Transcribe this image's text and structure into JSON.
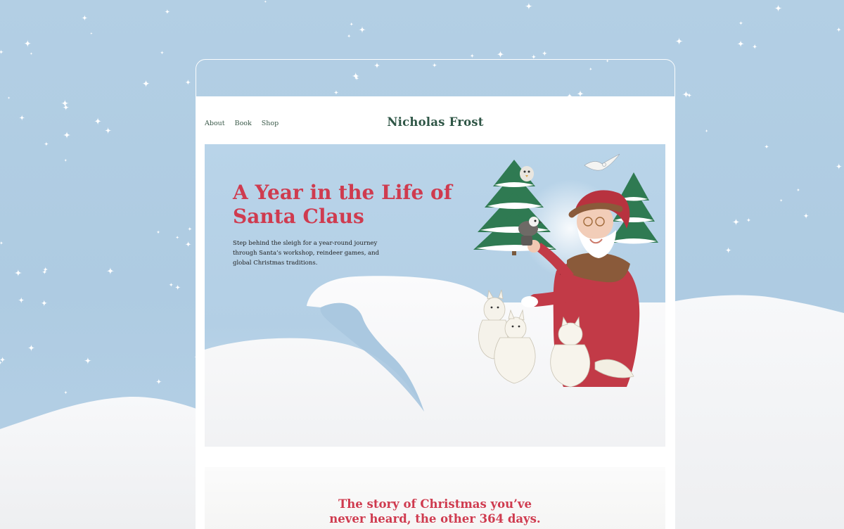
{
  "site": {
    "title": "Nicholas Frost"
  },
  "nav": {
    "items": [
      {
        "label": "About"
      },
      {
        "label": "Book"
      },
      {
        "label": "Shop"
      }
    ]
  },
  "hero": {
    "title": "A Year in the Life of Santa Claus",
    "description": "Step behind the sleigh for a year-round journey through Santa’s workshop, reindeer games, and global Christmas traditions.",
    "illustration": "santa-with-animals-illustration"
  },
  "section2": {
    "title": "The story of Christmas you’ve\nnever heard, the other 364 days."
  },
  "colors": {
    "accent_red": "#cf3b4f",
    "brand_green": "#2f5646",
    "sky_blue": "#b3cfe4",
    "snow_white": "#ffffff"
  }
}
